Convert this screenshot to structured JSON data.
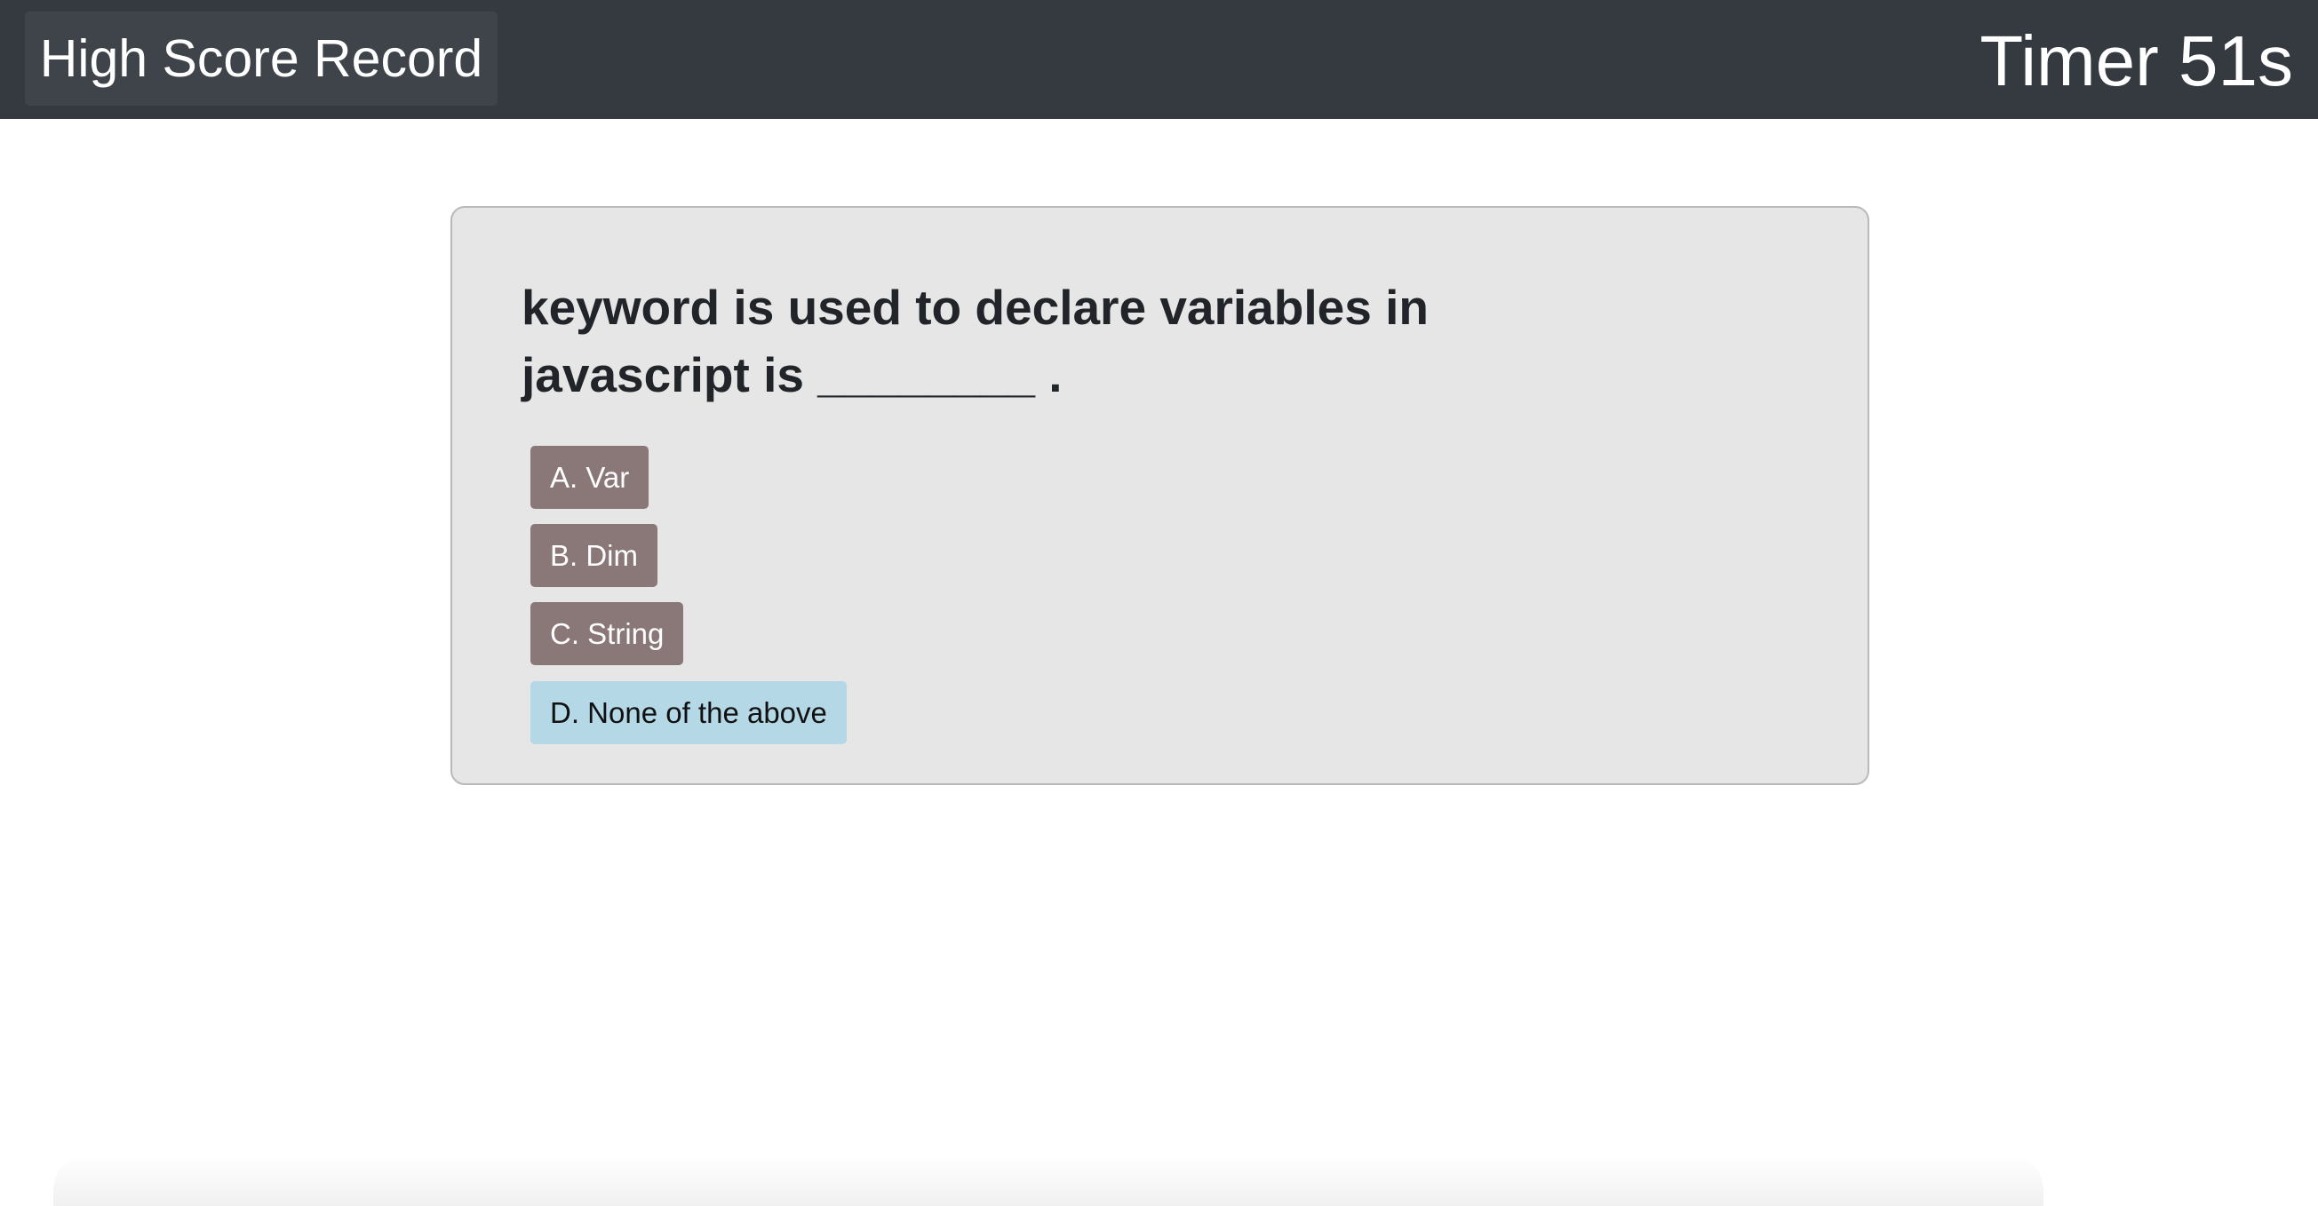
{
  "header": {
    "high_score_label": "High Score Record",
    "timer_text": "Timer 51s"
  },
  "quiz": {
    "question": "keyword is used to declare variables in javascript is ________ .",
    "answers": [
      {
        "label": "A. Var",
        "state": "normal"
      },
      {
        "label": "B. Dim",
        "state": "normal"
      },
      {
        "label": "C. String",
        "state": "normal"
      },
      {
        "label": "D. None of the above",
        "state": "selected"
      }
    ]
  },
  "colors": {
    "header_bg": "#343a40",
    "card_bg": "#e6e6e6",
    "answer_bg": "#8a7778",
    "answer_selected_bg": "#b4d8e6"
  }
}
